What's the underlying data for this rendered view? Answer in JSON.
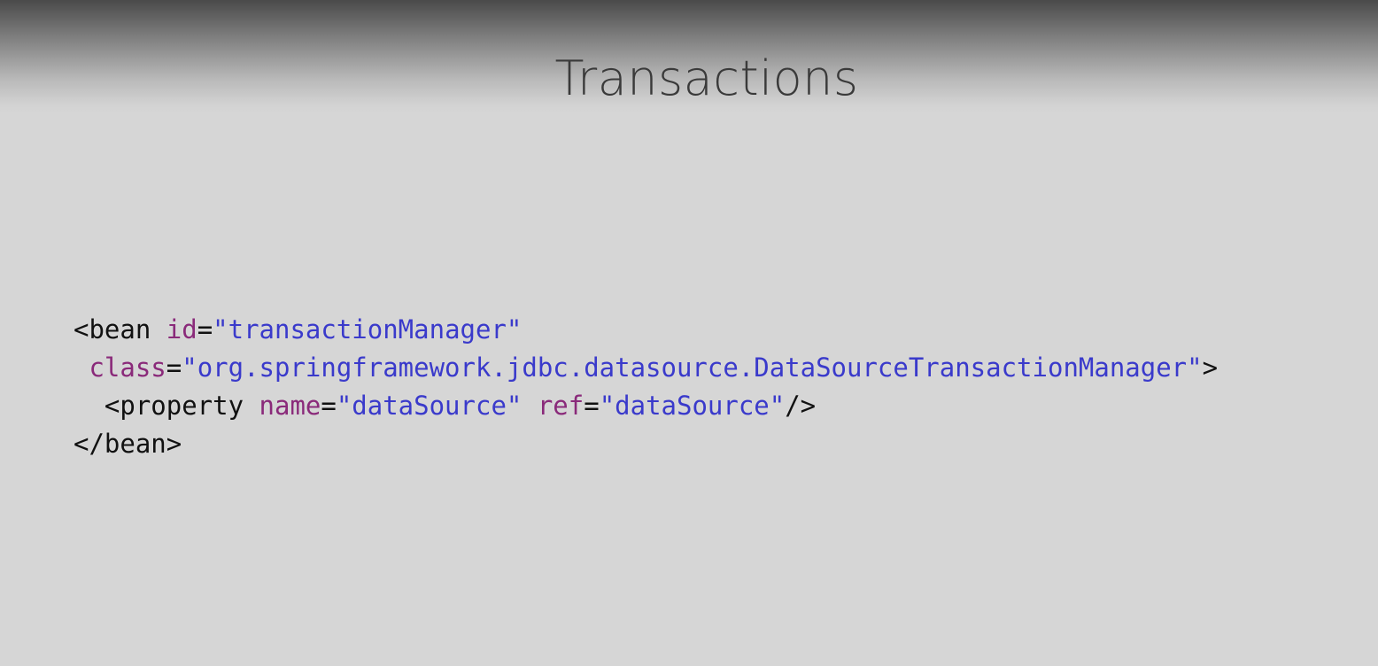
{
  "slide": {
    "title": "Transactions"
  },
  "colors": {
    "background": "#d6d6d6",
    "header_top": "#4a4a4a",
    "title_text": "#3a3a3a",
    "code_text": "#111111",
    "attribute_name": "#8a2a7a",
    "attribute_value": "#3a3acb"
  },
  "code": {
    "line1": {
      "indent": "",
      "open": "<bean",
      "sp1": " ",
      "attr1": "id",
      "eq1": "=",
      "val1": "\"transactionManager\""
    },
    "line2": {
      "indent": " ",
      "attr1": "class",
      "eq1": "=",
      "val1": "\"org.springframework.jdbc.datasource.DataSourceTransactionManager\"",
      "close": ">"
    },
    "line3": {
      "indent": "  ",
      "open": "<property",
      "sp1": " ",
      "attr1": "name",
      "eq1": "=",
      "val1": "\"dataSource\"",
      "sp2": " ",
      "attr2": "ref",
      "eq2": "=",
      "val2": "\"dataSource\"",
      "close": "/>"
    },
    "line4": {
      "indent": "",
      "close": "</bean>"
    }
  }
}
